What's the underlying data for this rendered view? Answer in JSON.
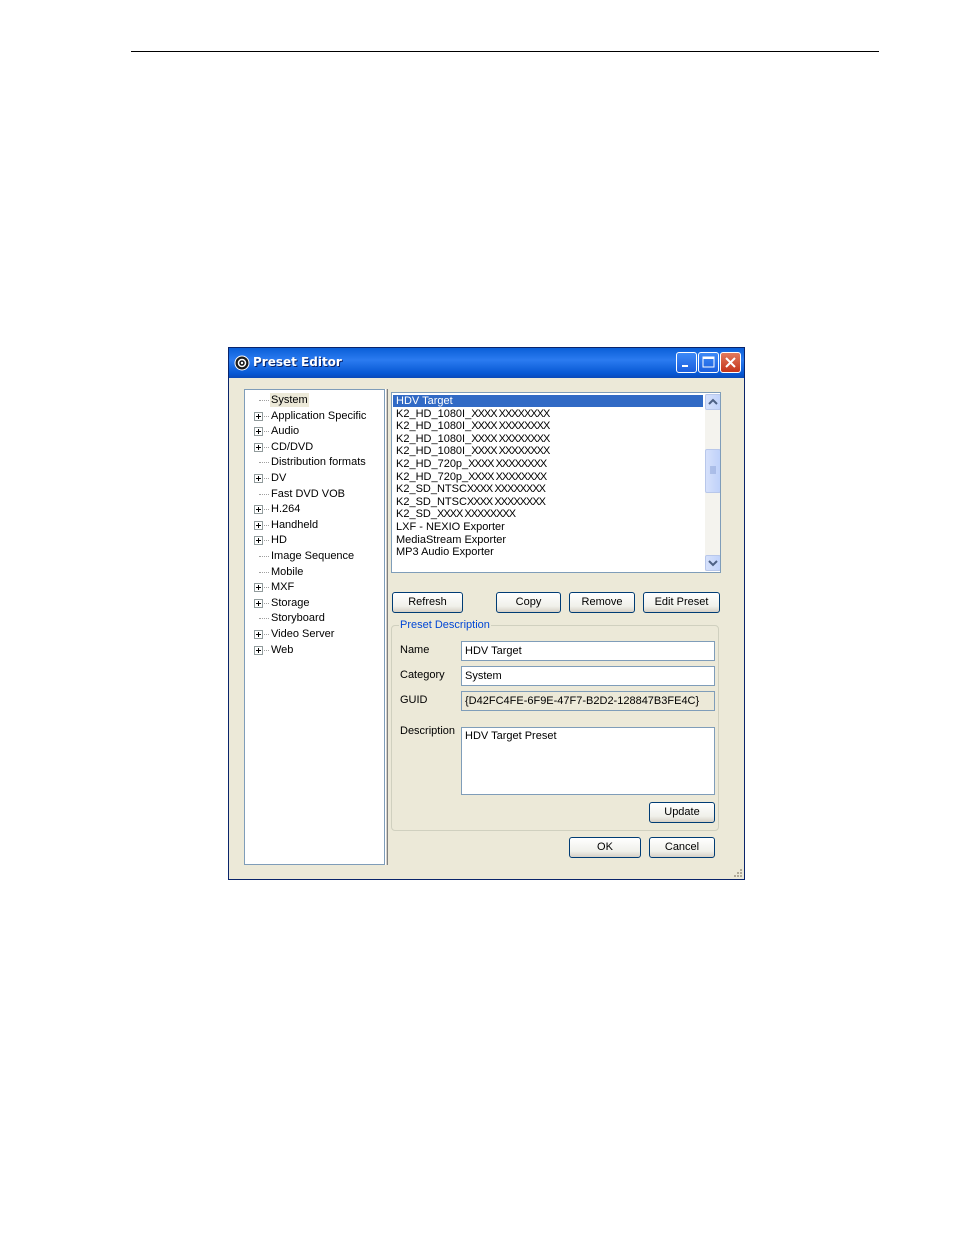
{
  "window": {
    "title": "Preset Editor",
    "colors": {
      "titlebar": "#0a5fd8",
      "face": "#ece9d8",
      "selection": "#316ac5",
      "group_title": "#0046d5"
    }
  },
  "tree": {
    "items": [
      {
        "label": "System",
        "expandable": false,
        "selected": true
      },
      {
        "label": "Application Specific",
        "expandable": true
      },
      {
        "label": "Audio",
        "expandable": true
      },
      {
        "label": "CD/DVD",
        "expandable": true
      },
      {
        "label": "Distribution formats",
        "expandable": false
      },
      {
        "label": "DV",
        "expandable": true
      },
      {
        "label": "Fast DVD VOB",
        "expandable": false
      },
      {
        "label": "H.264",
        "expandable": true
      },
      {
        "label": "Handheld",
        "expandable": true
      },
      {
        "label": "HD",
        "expandable": true
      },
      {
        "label": "Image Sequence",
        "expandable": false
      },
      {
        "label": "Mobile",
        "expandable": false
      },
      {
        "label": "MXF",
        "expandable": true
      },
      {
        "label": "Storage",
        "expandable": true
      },
      {
        "label": "Storyboard",
        "expandable": false
      },
      {
        "label": "Video Server",
        "expandable": true
      },
      {
        "label": "Web",
        "expandable": true
      }
    ]
  },
  "preset_list": {
    "items": [
      {
        "label": "HDV Target",
        "redacted": "",
        "selected": true
      },
      {
        "label": "K2_HD_1080I_",
        "redacted": "XXXX XXXXXXXX"
      },
      {
        "label": "K2_HD_1080I_",
        "redacted": "XXXX XXXXXXXX"
      },
      {
        "label": "K2_HD_1080I_",
        "redacted": "XXXX XXXXXXXX"
      },
      {
        "label": "K2_HD_1080I_",
        "redacted": "XXXX XXXXXXXX"
      },
      {
        "label": "K2_HD_720p_",
        "redacted": "XXXX XXXXXXXX"
      },
      {
        "label": "K2_HD_720p_",
        "redacted": "XXXX XXXXXXXX"
      },
      {
        "label": "K2_SD_NTSC",
        "redacted": "XXXX XXXXXXXX"
      },
      {
        "label": "K2_SD_NTSC",
        "redacted": "XXXX XXXXXXXX"
      },
      {
        "label": "K2_SD_",
        "redacted": "XXXX XXXXXXXX"
      },
      {
        "label": "LXF - NEXIO Exporter",
        "redacted": ""
      },
      {
        "label": "MediaStream Exporter",
        "redacted": ""
      },
      {
        "label": "MP3 Audio Exporter",
        "redacted": ""
      }
    ]
  },
  "buttons": {
    "refresh": "Refresh",
    "copy": "Copy",
    "remove": "Remove",
    "edit_preset": "Edit Preset",
    "update": "Update",
    "ok": "OK",
    "cancel": "Cancel"
  },
  "description_group": {
    "title": "Preset Description",
    "name_label": "Name",
    "name_value": "HDV Target",
    "category_label": "Category",
    "category_value": "System",
    "guid_label": "GUID",
    "guid_value": "{D42FC4FE-6F9E-47F7-B2D2-128847B3FE4C}",
    "description_label": "Description",
    "description_value": "HDV Target Preset"
  }
}
